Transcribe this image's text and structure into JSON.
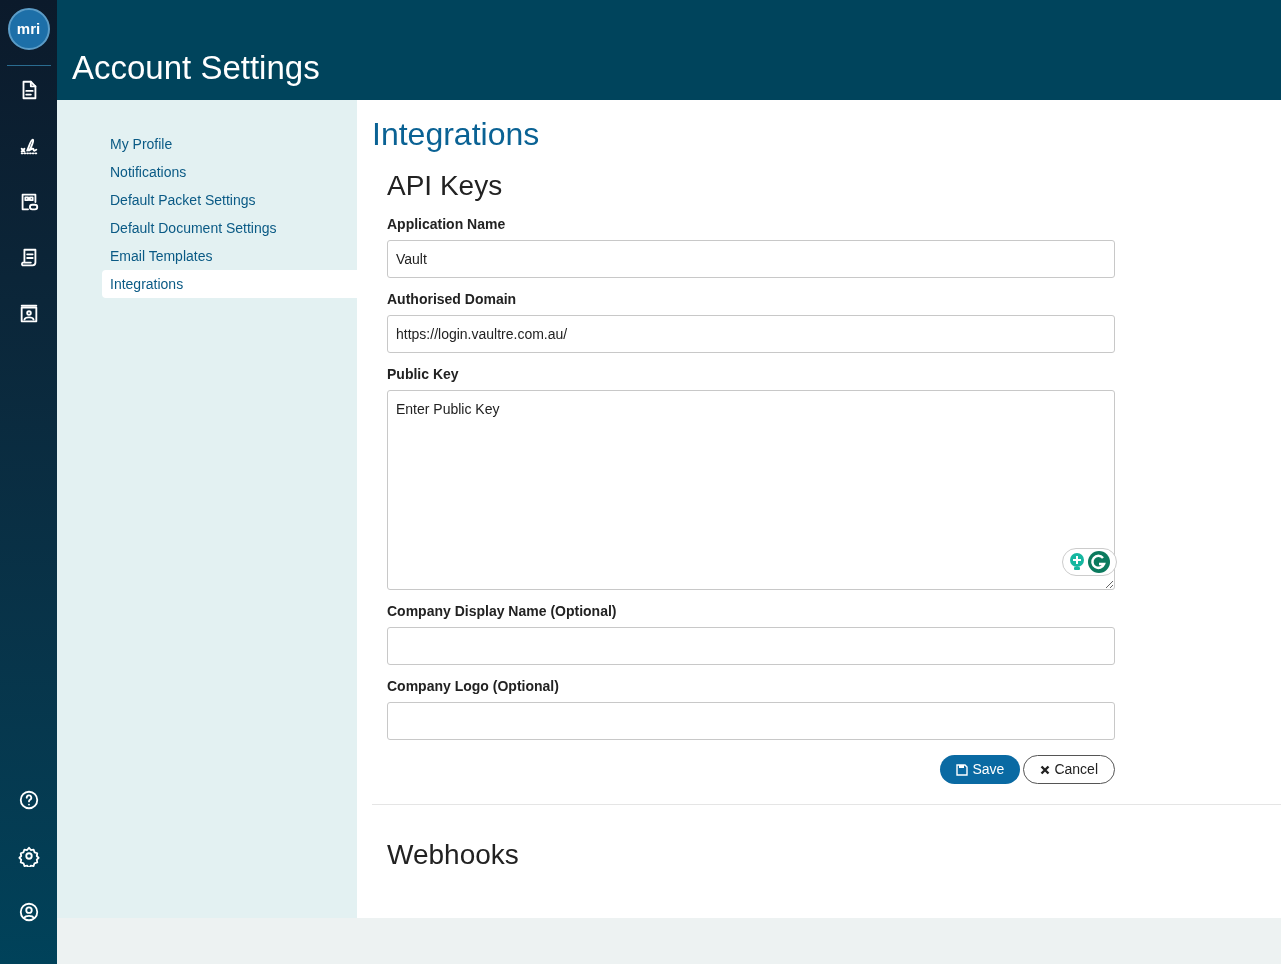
{
  "rail": {
    "logo": "mri",
    "top_icons": [
      {
        "kind": "document"
      },
      {
        "kind": "signature"
      },
      {
        "kind": "link-form"
      },
      {
        "kind": "receipt"
      },
      {
        "kind": "contact"
      }
    ],
    "bottom_icons": [
      {
        "kind": "help"
      },
      {
        "kind": "settings"
      },
      {
        "kind": "account"
      }
    ]
  },
  "header": {
    "title": "Account Settings"
  },
  "nav": [
    {
      "label": "My Profile",
      "selected": false
    },
    {
      "label": "Notifications",
      "selected": false
    },
    {
      "label": "Default Packet Settings",
      "selected": false
    },
    {
      "label": "Default Document Settings",
      "selected": false
    },
    {
      "label": "Email Templates",
      "selected": false
    },
    {
      "label": "Integrations",
      "selected": true
    }
  ],
  "page_title": "Integrations",
  "api_keys": {
    "heading": "API Keys",
    "fields": [
      {
        "kind": "input",
        "label": "Application Name",
        "value": "Vault"
      },
      {
        "kind": "input",
        "label": "Authorised Domain",
        "value": "https://login.vaultre.com.au/"
      },
      {
        "kind": "textarea",
        "label": "Public Key",
        "placeholder": "Enter Public Key"
      },
      {
        "kind": "input",
        "label": "Company Display Name (Optional)"
      },
      {
        "kind": "input",
        "label": "Company Logo (Optional)"
      }
    ],
    "buttons": [
      {
        "kind": "primary",
        "label": "Save"
      },
      {
        "kind": "secondary",
        "label": "Cancel"
      }
    ]
  },
  "webhooks": {
    "heading": "Webhooks"
  }
}
